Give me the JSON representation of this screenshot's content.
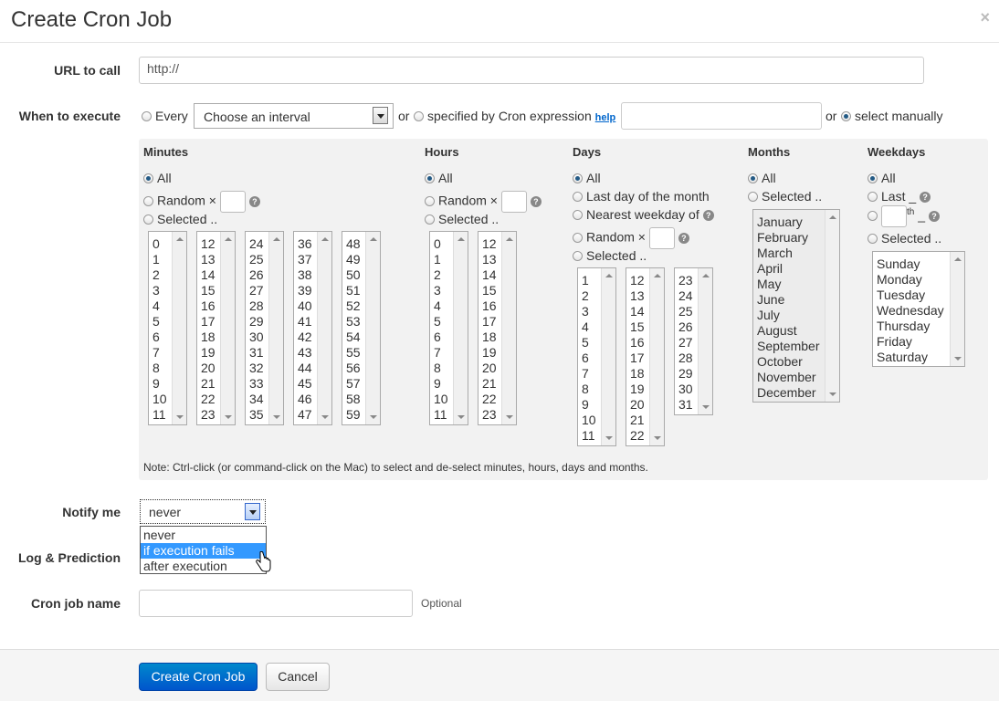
{
  "modal": {
    "title": "Create Cron Job",
    "close": "×"
  },
  "url": {
    "label": "URL to call",
    "value": "http://"
  },
  "when": {
    "label": "When to execute",
    "every_label": "Every",
    "interval_placeholder": "Choose an interval",
    "or1": "or",
    "cron_label": "specified by Cron expression",
    "help": "help",
    "or2": "or",
    "manual_label": "select manually"
  },
  "minutes": {
    "title": "Minutes",
    "all": "All",
    "random": "Random ×",
    "selected": "Selected ..",
    "col1": "0\n1\n2\n3\n4\n5\n6\n7\n8\n9\n10\n11",
    "col2": "12\n13\n14\n15\n16\n17\n18\n19\n20\n21\n22\n23",
    "col3": "24\n25\n26\n27\n28\n29\n30\n31\n32\n33\n34\n35",
    "col4": "36\n37\n38\n39\n40\n41\n42\n43\n44\n45\n46\n47",
    "col5": "48\n49\n50\n51\n52\n53\n54\n55\n56\n57\n58\n59"
  },
  "hours": {
    "title": "Hours",
    "all": "All",
    "random": "Random ×",
    "selected": "Selected ..",
    "col1": "0\n1\n2\n3\n4\n5\n6\n7\n8\n9\n10\n11",
    "col2": "12\n13\n14\n15\n16\n17\n18\n19\n20\n21\n22\n23"
  },
  "days": {
    "title": "Days",
    "all": "All",
    "last_day": "Last day of the month",
    "nearest": "Nearest weekday of",
    "random": "Random ×",
    "selected": "Selected ..",
    "col1": "1\n2\n3\n4\n5\n6\n7\n8\n9\n10\n11",
    "col2": "12\n13\n14\n15\n16\n17\n18\n19\n20\n21\n22",
    "col3": "23\n24\n25\n26\n27\n28\n29\n30\n31"
  },
  "months": {
    "title": "Months",
    "all": "All",
    "selected": "Selected ..",
    "list": "January\nFebruary\nMarch\nApril\nMay\nJune\nJuly\nAugust\nSeptember\nOctober\nNovember\nDecember"
  },
  "weekdays": {
    "title": "Weekdays",
    "all": "All",
    "last": "Last _",
    "th": "th",
    "th_suffix": "_",
    "selected": "Selected ..",
    "list": "Sunday\nMonday\nTuesday\nWednesday\nThursday\nFriday\nSaturday"
  },
  "note": "Note: Ctrl-click (or command-click on the Mac) to select and de-select minutes, hours, days and months.",
  "notify": {
    "label": "Notify me",
    "value": "never",
    "options": [
      "never",
      "if execution fails",
      "after execution"
    ],
    "highlighted_index": 1
  },
  "log": {
    "label": "Log & Prediction"
  },
  "name": {
    "label": "Cron job name",
    "hint": "Optional"
  },
  "footer": {
    "create": "Create Cron Job",
    "cancel": "Cancel"
  },
  "colors": {
    "primary": "#0066cc",
    "panel": "#f2f2f2",
    "highlight": "#3399ff"
  }
}
